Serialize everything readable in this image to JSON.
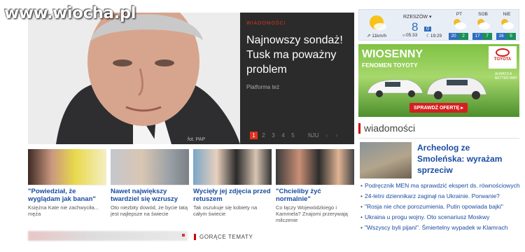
{
  "watermark": "www.wiocha.pl",
  "hero": {
    "category": "WIADOMOŚCI",
    "title": "Najnowszy sondaż! Tusk ma poważny problem",
    "subtitle": "Platforma też",
    "credit": "fot. PAP",
    "pages": [
      "1",
      "2",
      "3",
      "4",
      "5"
    ],
    "next_label": "NJU",
    "prev_arrow": "‹",
    "next_arrow": "›"
  },
  "thumbs": [
    {
      "title": "\"Powiedział, że wyglądam jak banan\"",
      "desc": "Księżna Kate nie zachwyciła... męża"
    },
    {
      "title": "Nawet największy twardziel się wzruszy",
      "desc": "Oto niezbity dowód, że bycie tatą jest najlepsze na świecie"
    },
    {
      "title": "Wycięły jej zdjęcia przed retuszem",
      "desc": "Tak oszukuje się kobiety na całym świecie"
    },
    {
      "title": "\"Chcieliby żyć normalnie\"",
      "desc": "Co łączy Wojewódzkiego i Kammela? Znajomi przerywają milczenie"
    }
  ],
  "hot_topics": "GORĄCE TEMATY",
  "weather": {
    "city": "RZESZÓW ▾",
    "temp": "8",
    "badge": "0",
    "wind": "11km/h",
    "sunrise": "05:33",
    "sunset": "19:29",
    "days": [
      {
        "name": "PT",
        "temp": "20"
      },
      {
        "name": "SOB",
        "temp": "17"
      },
      {
        "name": "NIE",
        "temp": "16"
      }
    ],
    "day_lows": [
      "2",
      "7",
      "5"
    ]
  },
  "ad": {
    "title": "WIOSENNY",
    "subtitle": "FENOMEN TOYOTY",
    "brand": "TOYOTA",
    "tagline": "ALWAYS A BETTER WAY",
    "button": "SPRAWDŹ OFERTĘ ▸"
  },
  "news": {
    "heading": "wiadomości",
    "lead_title": "Archeolog ze Smoleńska: wyrażam sprzeciw",
    "items": [
      "Podręcznik MEN ma sprawdzić ekspert ds. równościowych",
      "24-letni dziennikarz zaginął na Ukrainie. Porwanie?",
      "\"Rosja nie chce porozumienia. Putin opowiada bajki\"",
      "Ukraina u progu wojny. Oto scenariusz Moskwy",
      "\"Wszyscy byli pijani\". Śmiertelny wypadek w Klamrach"
    ]
  },
  "colors": {
    "accent": "#e0331f",
    "link": "#1a4ca1",
    "panel": "#2b2b2b",
    "weather_blue": "#2d6ec0"
  }
}
